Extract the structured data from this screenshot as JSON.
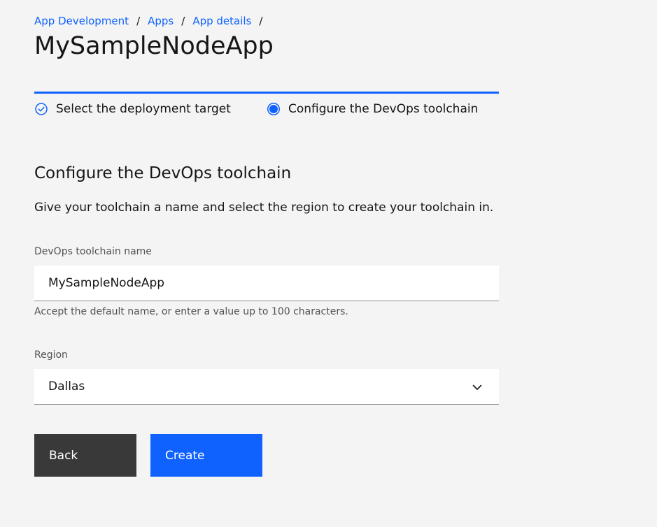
{
  "breadcrumb": {
    "items": [
      {
        "label": "App Development"
      },
      {
        "label": "Apps"
      },
      {
        "label": "App details"
      }
    ],
    "separator": "/"
  },
  "page": {
    "title": "MySampleNodeApp"
  },
  "progress": {
    "steps": [
      {
        "label": "Select the deployment target",
        "state": "complete",
        "icon": "checkmark-circle-icon"
      },
      {
        "label": "Configure the DevOps toolchain",
        "state": "current",
        "icon": "current-step-icon"
      }
    ]
  },
  "section": {
    "title": "Configure the DevOps toolchain",
    "description": "Give your toolchain a name and select the region to create your toolchain in."
  },
  "form": {
    "name_label": "DevOps toolchain name",
    "name_value": "MySampleNodeApp",
    "name_helper": "Accept the default name, or enter a value up to 100 characters.",
    "region_label": "Region",
    "region_value": "Dallas"
  },
  "buttons": {
    "back_label": "Back",
    "create_label": "Create"
  },
  "colors": {
    "accent": "#0f62fe",
    "background": "#f4f4f4",
    "secondary_button": "#393939",
    "text": "#161616"
  }
}
